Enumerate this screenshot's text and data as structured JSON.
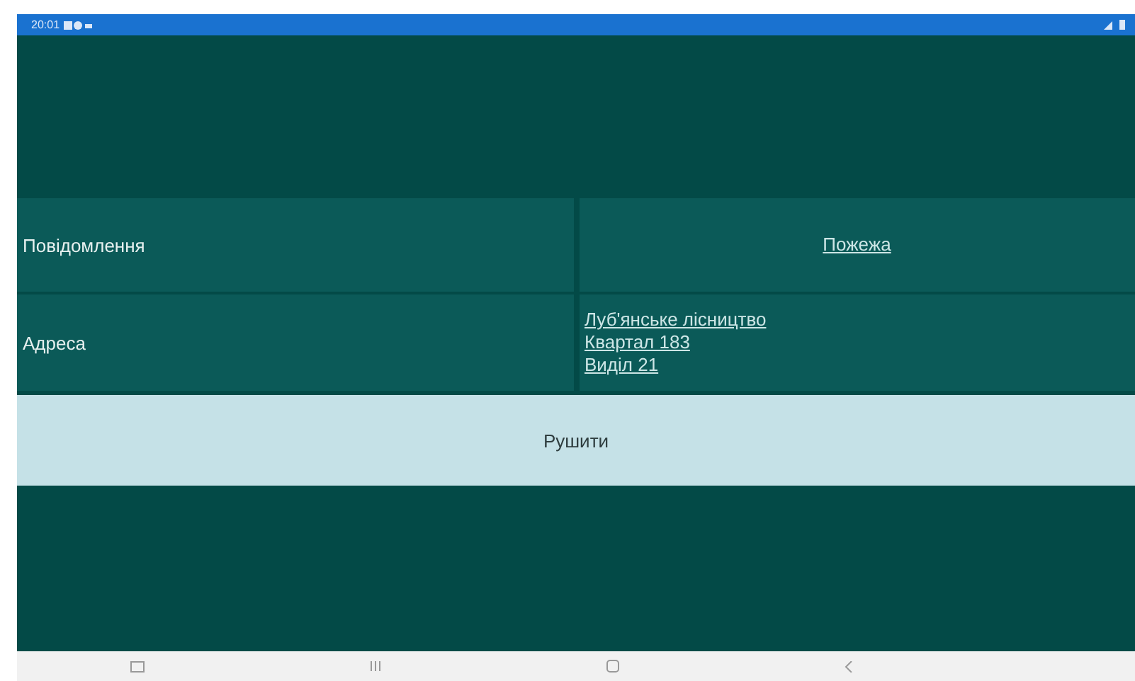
{
  "status_bar": {
    "time": "20:01"
  },
  "rows": [
    {
      "label": "Повідомлення",
      "links": [
        "Пожежа"
      ],
      "kind": "single"
    },
    {
      "label": "Адреса",
      "links": [
        "Луб'янське лісництво",
        "Квартал 183",
        "Виділ 21"
      ],
      "kind": "list"
    }
  ],
  "action_button": "Рушити"
}
